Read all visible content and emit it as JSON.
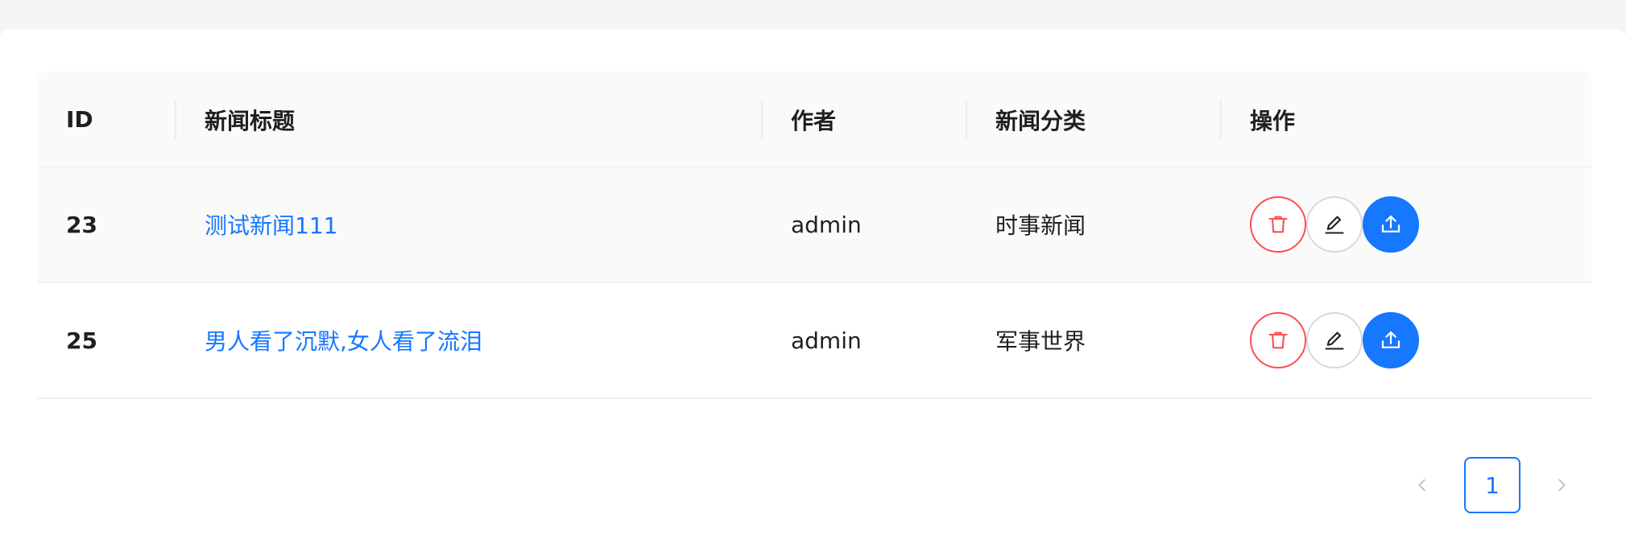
{
  "table": {
    "columns": {
      "id": "ID",
      "title": "新闻标题",
      "author": "作者",
      "category": "新闻分类",
      "actions": "操作"
    },
    "rows": [
      {
        "id": "23",
        "title": "测试新闻111",
        "author": "admin",
        "category": "时事新闻"
      },
      {
        "id": "25",
        "title": "男人看了沉默,女人看了流泪",
        "author": "admin",
        "category": "军事世界"
      }
    ],
    "row_actions": {
      "delete_icon": "trash-icon",
      "edit_icon": "pencil-icon",
      "publish_icon": "upload-icon"
    }
  },
  "pagination": {
    "current_page": "1",
    "prev_icon": "chevron-left-icon",
    "next_icon": "chevron-right-icon"
  },
  "colors": {
    "primary": "#1677ff",
    "danger": "#ff4d4f",
    "header_bg": "#fafafa",
    "border": "#f0f0f0"
  }
}
